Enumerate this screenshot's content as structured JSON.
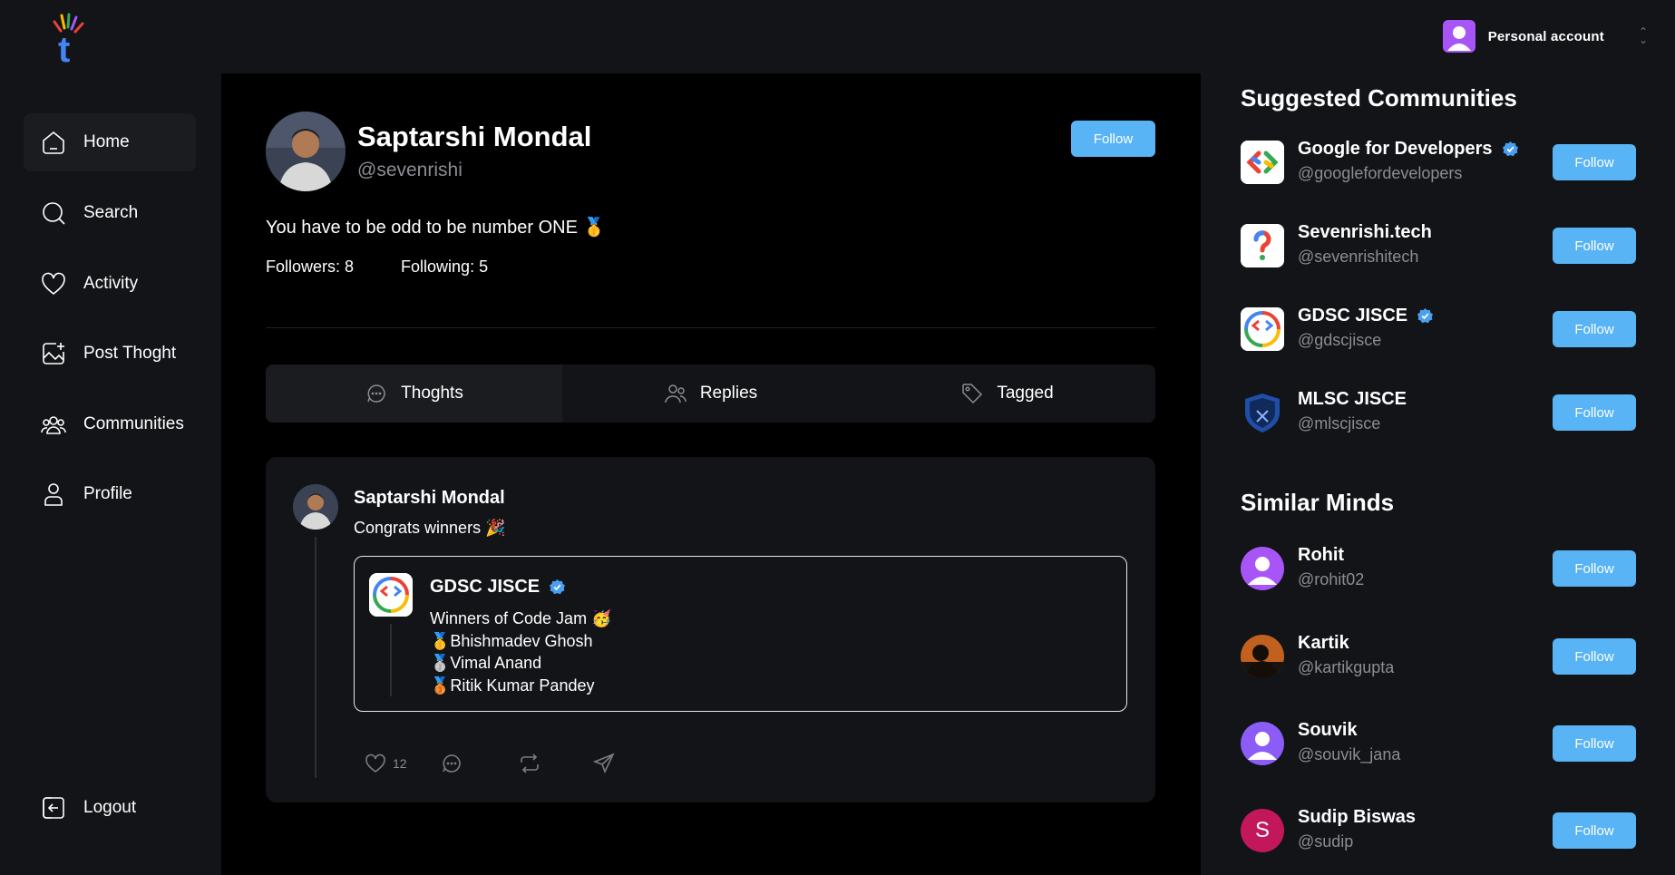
{
  "account": {
    "label": "Personal account"
  },
  "nav": [
    {
      "label": "Home",
      "icon": "home-icon"
    },
    {
      "label": "Search",
      "icon": "search-icon"
    },
    {
      "label": "Activity",
      "icon": "heart-icon"
    },
    {
      "label": "Post Thoght",
      "icon": "image-plus-icon"
    },
    {
      "label": "Communities",
      "icon": "users-icon"
    },
    {
      "label": "Profile",
      "icon": "user-icon"
    }
  ],
  "logout": {
    "label": "Logout"
  },
  "profile": {
    "name": "Saptarshi Mondal",
    "handle": "@sevenrishi",
    "follow_label": "Follow",
    "bio": "You have to be odd to be number ONE 🥇",
    "followers": "Followers: 8",
    "following": "Following: 5"
  },
  "tabs": [
    {
      "label": "Thoghts",
      "icon": "chat-bubble-icon"
    },
    {
      "label": "Replies",
      "icon": "users-icon"
    },
    {
      "label": "Tagged",
      "icon": "tag-icon"
    }
  ],
  "post": {
    "author": "Saptarshi Mondal",
    "text": "Congrats winners 🎉",
    "embed": {
      "author": "GDSC JISCE",
      "lines": [
        "Winners of Code Jam 🥳",
        "🥇Bhishmadev Ghosh",
        "🥈Vimal Anand",
        "🥉Ritik Kumar Pandey"
      ]
    },
    "like_count": "12"
  },
  "suggested": {
    "title": "Suggested Communities",
    "items": [
      {
        "name": "Google for Developers",
        "handle": "@googlefordevelopers",
        "verified": true,
        "button": "Follow"
      },
      {
        "name": "Sevenrishi.tech",
        "handle": "@sevenrishitech",
        "verified": false,
        "button": "Follow"
      },
      {
        "name": "GDSC JISCE",
        "handle": "@gdscjisce",
        "verified": true,
        "button": "Follow"
      },
      {
        "name": "MLSC JISCE",
        "handle": "@mlscjisce",
        "verified": false,
        "button": "Follow"
      }
    ]
  },
  "similar": {
    "title": "Similar Minds",
    "items": [
      {
        "name": "Rohit",
        "handle": "@rohit02",
        "button": "Follow"
      },
      {
        "name": "Kartik",
        "handle": "@kartikgupta",
        "button": "Follow"
      },
      {
        "name": "Souvik",
        "handle": "@souvik_jana",
        "button": "Follow"
      },
      {
        "name": "Sudip Biswas",
        "handle": "@sudip",
        "button": "Follow",
        "initial": "S"
      }
    ]
  },
  "colors": {
    "accent": "#58b4f5",
    "panel": "#121417",
    "verified": "#4a9ff0"
  }
}
